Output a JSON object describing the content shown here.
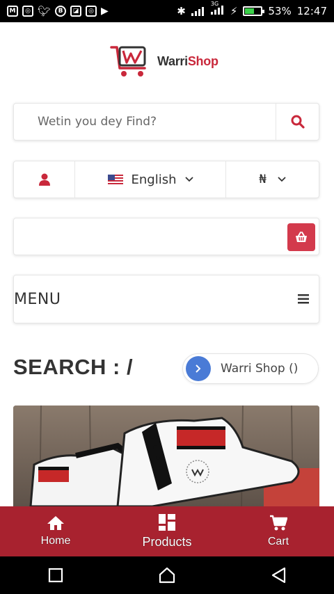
{
  "status_bar": {
    "battery": "53%",
    "time": "12:47",
    "network_type": "3G",
    "notification_icons": [
      "gmail-icon",
      "instagram-icon",
      "twitter-icon",
      "b-icon",
      "gallery-icon",
      "instagram-icon",
      "play-icon"
    ]
  },
  "brand": {
    "name_part1": "Warri",
    "name_part2": "Shop",
    "accent_color": "#c9283b"
  },
  "search": {
    "placeholder": "Wetin you dey Find?"
  },
  "options": {
    "language": "English",
    "currency": "₦"
  },
  "menu": {
    "label": "MENU"
  },
  "page": {
    "title": "SEARCH : /",
    "breadcrumb": "Warri Shop ()"
  },
  "bottom_nav": {
    "items": [
      {
        "label": "Home",
        "icon": "home-icon"
      },
      {
        "label": "Products",
        "icon": "grid-icon"
      },
      {
        "label": "Cart",
        "icon": "cart-icon"
      }
    ]
  },
  "colors": {
    "nav_bar": "#a8222f",
    "cart_button": "#d33a4c",
    "breadcrumb_circle": "#4a7bd6"
  }
}
